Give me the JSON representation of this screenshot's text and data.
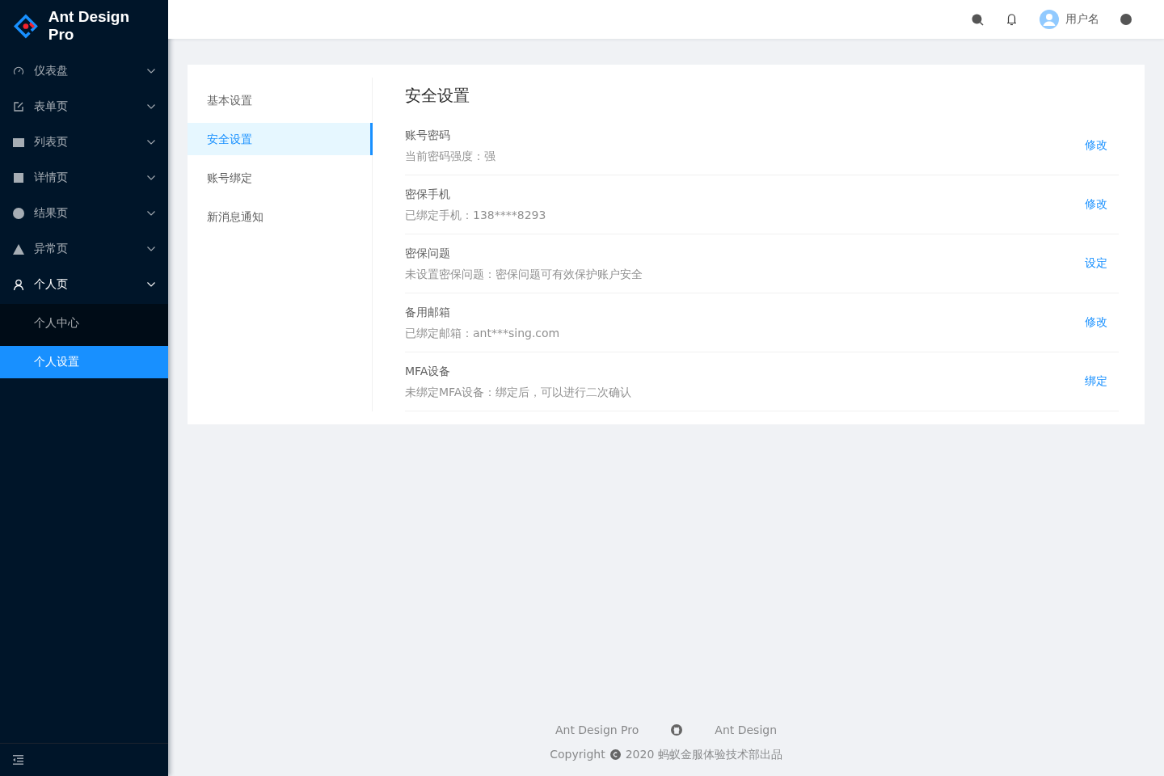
{
  "brand": {
    "title": "Ant Design Pro"
  },
  "sidebar": {
    "items": [
      {
        "label": "仪表盘",
        "expanded": false
      },
      {
        "label": "表单页",
        "expanded": false
      },
      {
        "label": "列表页",
        "expanded": false
      },
      {
        "label": "详情页",
        "expanded": false
      },
      {
        "label": "结果页",
        "expanded": false
      },
      {
        "label": "异常页",
        "expanded": false
      },
      {
        "label": "个人页",
        "expanded": true,
        "children": [
          {
            "label": "个人中心",
            "selected": false
          },
          {
            "label": "个人设置",
            "selected": true
          }
        ]
      }
    ]
  },
  "header": {
    "username": "用户名"
  },
  "settings_menu": [
    {
      "label": "基本设置",
      "selected": false
    },
    {
      "label": "安全设置",
      "selected": true
    },
    {
      "label": "账号绑定",
      "selected": false
    },
    {
      "label": "新消息通知",
      "selected": false
    }
  ],
  "security": {
    "title": "安全设置",
    "items": [
      {
        "title": "账号密码",
        "description": "当前密码强度：强",
        "action": "修改"
      },
      {
        "title": "密保手机",
        "description": "已绑定手机：138****8293",
        "action": "修改"
      },
      {
        "title": "密保问题",
        "description": "未设置密保问题：密保问题可有效保护账户安全",
        "action": "设定"
      },
      {
        "title": "备用邮箱",
        "description": "已绑定邮箱：ant***sing.com",
        "action": "修改"
      },
      {
        "title": "MFA设备",
        "description": "未绑定MFA设备：绑定后，可以进行二次确认",
        "action": "绑定"
      }
    ]
  },
  "footer": {
    "links": [
      "Ant Design Pro",
      "Ant Design"
    ],
    "copyright_prefix": "Copyright",
    "copyright_text": "2020 蚂蚁金服体验技术部出品"
  }
}
